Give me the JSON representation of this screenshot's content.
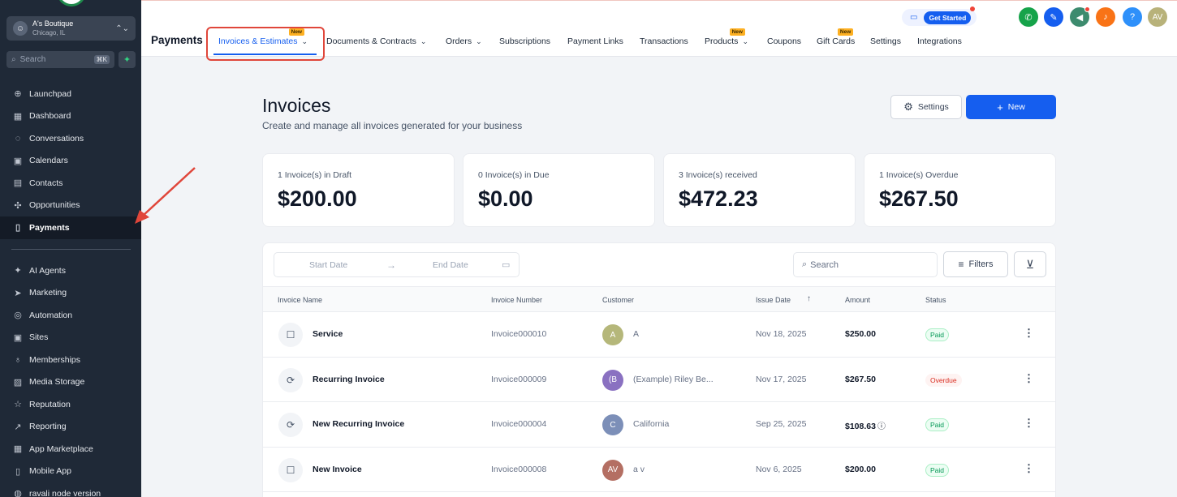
{
  "sidebar": {
    "location": {
      "avatar": "☺",
      "name": "A's Boutique",
      "city": "Chicago, IL",
      "chevron": "⌃⌄"
    },
    "search": {
      "label": "Search",
      "shortcut": "⌘K"
    },
    "items_top": [
      {
        "icon": "rocket-icon",
        "glyph": "⊕",
        "label": "Launchpad"
      },
      {
        "icon": "dashboard-icon",
        "glyph": "▦",
        "label": "Dashboard"
      },
      {
        "icon": "chat-icon",
        "glyph": "◌",
        "label": "Conversations"
      },
      {
        "icon": "calendar-icon",
        "glyph": "▣",
        "label": "Calendars"
      },
      {
        "icon": "contacts-icon",
        "glyph": "▤",
        "label": "Contacts"
      },
      {
        "icon": "opportunities-icon",
        "glyph": "✣",
        "label": "Opportunities"
      },
      {
        "icon": "payments-icon",
        "glyph": "▯",
        "label": "Payments",
        "active": true
      }
    ],
    "items_bottom": [
      {
        "icon": "sparkle-icon",
        "glyph": "✦",
        "label": "AI Agents"
      },
      {
        "icon": "send-icon",
        "glyph": "➤",
        "label": "Marketing"
      },
      {
        "icon": "automation-icon",
        "glyph": "◎",
        "label": "Automation"
      },
      {
        "icon": "sites-icon",
        "glyph": "▣",
        "label": "Sites"
      },
      {
        "icon": "membership-icon",
        "glyph": "♁",
        "label": "Memberships"
      },
      {
        "icon": "media-icon",
        "glyph": "▨",
        "label": "Media Storage"
      },
      {
        "icon": "star-icon",
        "glyph": "☆",
        "label": "Reputation"
      },
      {
        "icon": "trend-icon",
        "glyph": "↗",
        "label": "Reporting"
      },
      {
        "icon": "apps-icon",
        "glyph": "▦",
        "label": "App Marketplace"
      },
      {
        "icon": "mobile-icon",
        "glyph": "▯",
        "label": "Mobile App"
      },
      {
        "icon": "db-icon",
        "glyph": "◍",
        "label": "ravali node version"
      }
    ]
  },
  "topbar": {
    "title": "Payments",
    "tabs": [
      {
        "label": "Invoices & Estimates",
        "caret": true,
        "badge": "New",
        "selected": true
      },
      {
        "label": "Documents & Contracts",
        "caret": true
      },
      {
        "label": "Orders",
        "caret": true
      },
      {
        "label": "Subscriptions"
      },
      {
        "label": "Payment Links"
      },
      {
        "label": "Transactions"
      },
      {
        "label": "Products",
        "caret": true,
        "badge": "New"
      },
      {
        "label": "Coupons"
      },
      {
        "label": "Gift Cards",
        "badge": "New"
      },
      {
        "label": "Settings"
      },
      {
        "label": "Integrations"
      }
    ],
    "get_started": "Get Started",
    "user_initials": "AV"
  },
  "page": {
    "title": "Invoices",
    "subtitle": "Create and manage all invoices generated for your business",
    "settings_label": "Settings",
    "new_label": "New"
  },
  "stats": [
    {
      "label": "1 Invoice(s) in Draft",
      "value": "$200.00"
    },
    {
      "label": "0 Invoice(s) in Due",
      "value": "$0.00"
    },
    {
      "label": "3 Invoice(s) received",
      "value": "$472.23"
    },
    {
      "label": "1 Invoice(s) Overdue",
      "value": "$267.50"
    }
  ],
  "filters": {
    "start_date": "Start Date",
    "end_date": "End Date",
    "search_placeholder": "Search",
    "filters_label": "Filters"
  },
  "table": {
    "columns": [
      "Invoice Name",
      "Invoice Number",
      "Customer",
      "Issue Date",
      "Amount",
      "Status"
    ],
    "rows": [
      {
        "icon": "document-icon",
        "glyph": "☐",
        "name": "Service",
        "number": "Invoice000010",
        "initials": "A",
        "avatar_color": "#b5b77a",
        "customer": "A",
        "date": "Nov 18, 2025",
        "amount": "$250.00",
        "info": false,
        "status": "Paid"
      },
      {
        "icon": "recurring-icon",
        "glyph": "⟳",
        "name": "Recurring Invoice",
        "number": "Invoice000009",
        "initials": "(B",
        "avatar_color": "#8a71c1",
        "customer": "(Example) Riley Be...",
        "date": "Nov 17, 2025",
        "amount": "$267.50",
        "info": false,
        "status": "Overdue"
      },
      {
        "icon": "recurring-icon",
        "glyph": "⟳",
        "name": "New Recurring Invoice",
        "number": "Invoice000004",
        "initials": "C",
        "avatar_color": "#7c8fb8",
        "customer": "California",
        "date": "Sep 25, 2025",
        "amount": "$108.63",
        "info": true,
        "status": "Paid"
      },
      {
        "icon": "document-icon",
        "glyph": "☐",
        "name": "New Invoice",
        "number": "Invoice000008",
        "initials": "AV",
        "avatar_color": "#b46f63",
        "customer": "a v",
        "date": "Nov 6, 2025",
        "amount": "$200.00",
        "info": false,
        "status": "Paid"
      }
    ]
  },
  "colors": {
    "primary": "#155eef",
    "sidebar": "#1f2937",
    "annotation": "#e0463a"
  }
}
